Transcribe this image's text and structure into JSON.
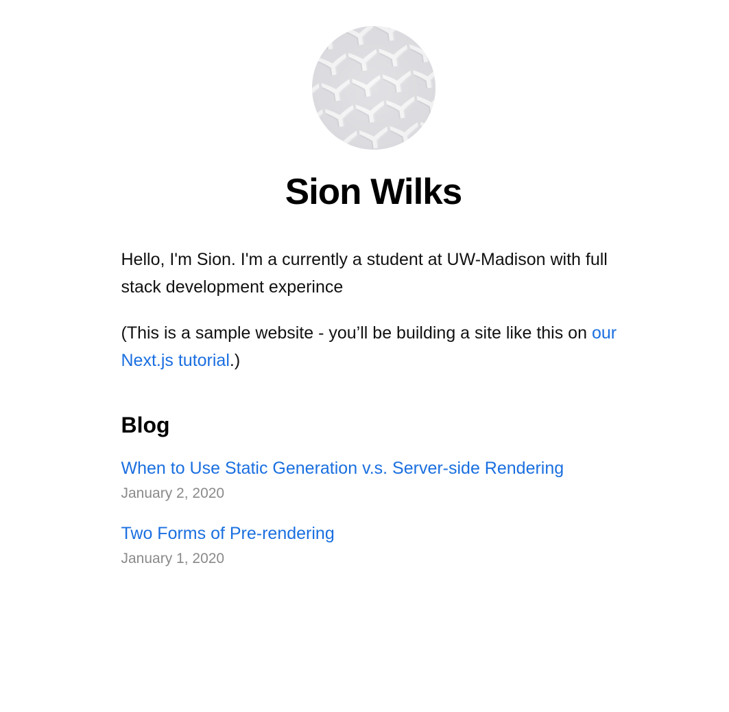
{
  "header": {
    "name": "Sion Wilks"
  },
  "intro": {
    "bio": "Hello, I'm Sion. I'm a currently a student at UW-Madison with full stack development experince",
    "note_prefix": "(This is a sample website - you’ll be building a site like this on ",
    "note_link": "our Next.js tutorial",
    "note_suffix": ".)"
  },
  "blog": {
    "heading": "Blog",
    "posts": [
      {
        "title": "When to Use Static Generation v.s. Server-side Rendering",
        "date": "January 2, 2020"
      },
      {
        "title": "Two Forms of Pre-rendering",
        "date": "January 1, 2020"
      }
    ]
  },
  "colors": {
    "link": "#1a6fe0",
    "date": "#8a8a8a"
  }
}
